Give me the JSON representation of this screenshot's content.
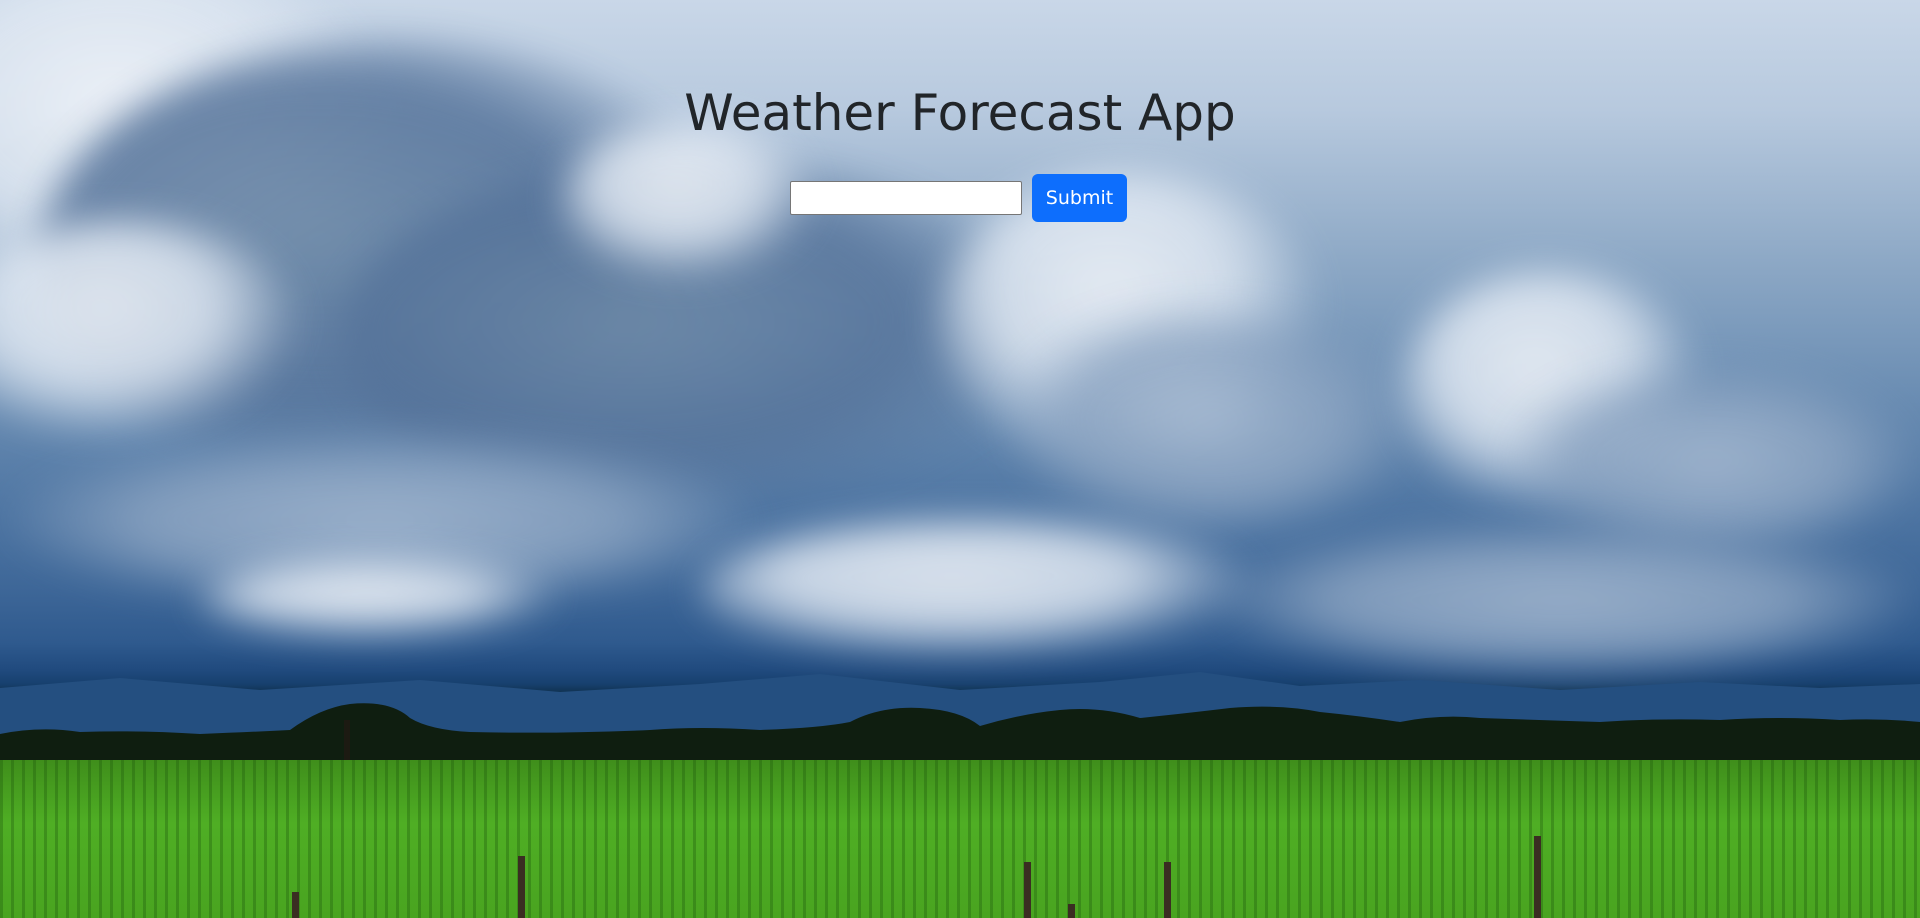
{
  "app": {
    "title": "Weather Forecast App"
  },
  "form": {
    "city_input_value": "",
    "city_input_placeholder": "",
    "submit_label": "Submit"
  },
  "colors": {
    "title_text": "#212529",
    "submit_button": "#0d6efd",
    "submit_text": "#ffffff"
  },
  "background": {
    "scene": "cloudy sky over green field"
  }
}
